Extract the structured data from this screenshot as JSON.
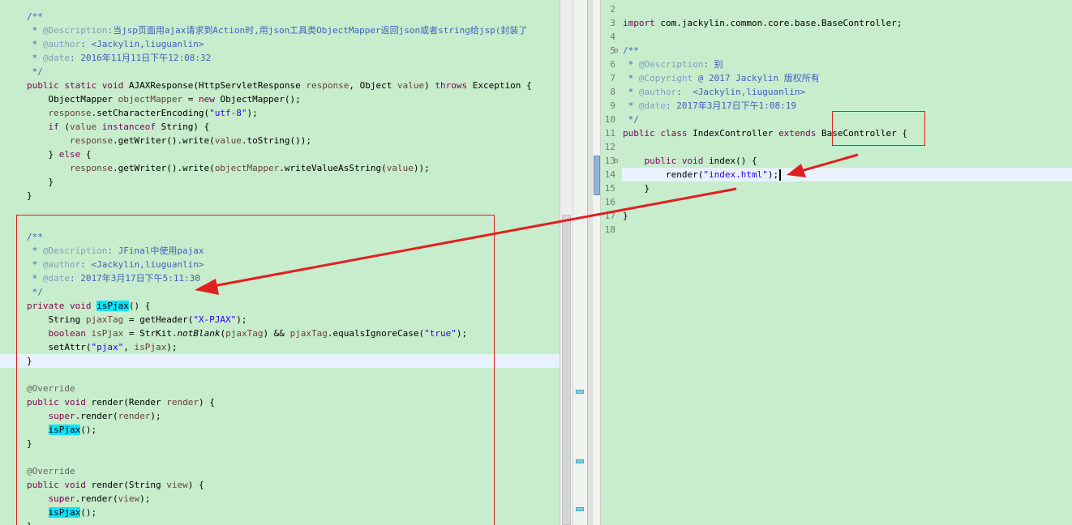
{
  "left_editor": {
    "lines": [
      [
        [
          "cm",
          "/**"
        ]
      ],
      [
        [
          "cm",
          " * "
        ],
        [
          "tag",
          "@Description"
        ],
        [
          "cm",
          ":当jsp页面用ajax请求到Action时,用json工具类ObjectMapper返回json或者string给jsp(封装了"
        ]
      ],
      [
        [
          "cm",
          " * "
        ],
        [
          "tag",
          "@author"
        ],
        [
          "cm",
          ": <Jackylin,liuguanlin>"
        ]
      ],
      [
        [
          "cm",
          " * "
        ],
        [
          "tag",
          "@date"
        ],
        [
          "cm",
          ": 2016年11月11日下午12:08:32"
        ]
      ],
      [
        [
          "cm",
          " */"
        ]
      ],
      [
        [
          "kw",
          "public static void "
        ],
        [
          "t",
          "AJAXResponse(HttpServletResponse "
        ],
        [
          "var",
          "response"
        ],
        [
          "t",
          ", Object "
        ],
        [
          "var",
          "value"
        ],
        [
          "t",
          ") "
        ],
        [
          "kw",
          "throws"
        ],
        [
          "t",
          " Exception {"
        ]
      ],
      [
        [
          "t",
          "    ObjectMapper "
        ],
        [
          "var",
          "objectMapper"
        ],
        [
          "t",
          " = "
        ],
        [
          "kw",
          "new"
        ],
        [
          "t",
          " ObjectMapper();"
        ]
      ],
      [
        [
          "t",
          "    "
        ],
        [
          "var",
          "response"
        ],
        [
          "t",
          ".setCharacterEncoding("
        ],
        [
          "str",
          "\"utf-8\""
        ],
        [
          "t",
          ");"
        ]
      ],
      [
        [
          "t",
          "    "
        ],
        [
          "kw",
          "if"
        ],
        [
          "t",
          " ("
        ],
        [
          "var",
          "value"
        ],
        [
          "t",
          " "
        ],
        [
          "kw",
          "instanceof"
        ],
        [
          "t",
          " String) {"
        ]
      ],
      [
        [
          "t",
          "        "
        ],
        [
          "var",
          "response"
        ],
        [
          "t",
          ".getWriter().write("
        ],
        [
          "var",
          "value"
        ],
        [
          "t",
          ".toString());"
        ]
      ],
      [
        [
          "t",
          "    } "
        ],
        [
          "kw",
          "else"
        ],
        [
          "t",
          " {"
        ]
      ],
      [
        [
          "t",
          "        "
        ],
        [
          "var",
          "response"
        ],
        [
          "t",
          ".getWriter().write("
        ],
        [
          "var",
          "objectMapper"
        ],
        [
          "t",
          ".writeValueAsString("
        ],
        [
          "var",
          "value"
        ],
        [
          "t",
          "));"
        ]
      ],
      [
        [
          "t",
          "    }"
        ]
      ],
      [
        [
          "t",
          "}"
        ]
      ],
      [],
      [],
      [
        [
          "cm",
          "/**"
        ]
      ],
      [
        [
          "cm",
          " * "
        ],
        [
          "tag",
          "@Description"
        ],
        [
          "cm",
          ": JFinal中使用pajax"
        ]
      ],
      [
        [
          "cm",
          " * "
        ],
        [
          "tag",
          "@author"
        ],
        [
          "cm",
          ": <Jackylin,liuguanlin>"
        ]
      ],
      [
        [
          "cm",
          " * "
        ],
        [
          "tag",
          "@date"
        ],
        [
          "cm",
          ": 2017年3月17日下午5:11:30"
        ]
      ],
      [
        [
          "cm",
          " */"
        ]
      ],
      [
        [
          "kw",
          "private void "
        ],
        [
          "hl",
          "isPjax"
        ],
        [
          "t",
          "() {"
        ]
      ],
      [
        [
          "t",
          "    String "
        ],
        [
          "var",
          "pjaxTag"
        ],
        [
          "t",
          " = getHeader("
        ],
        [
          "str",
          "\"X-PJAX\""
        ],
        [
          "t",
          ");"
        ]
      ],
      [
        [
          "t",
          "    "
        ],
        [
          "kw",
          "boolean"
        ],
        [
          "t",
          " "
        ],
        [
          "var",
          "isPjax"
        ],
        [
          "t",
          " = StrKit."
        ],
        [
          "ital",
          "notBlank"
        ],
        [
          "t",
          "("
        ],
        [
          "var",
          "pjaxTag"
        ],
        [
          "t",
          ") && "
        ],
        [
          "var",
          "pjaxTag"
        ],
        [
          "t",
          ".equalsIgnoreCase("
        ],
        [
          "str",
          "\"true\""
        ],
        [
          "t",
          ");"
        ]
      ],
      [
        [
          "t",
          "    setAttr("
        ],
        [
          "str",
          "\"pjax\""
        ],
        [
          "t",
          ", "
        ],
        [
          "var",
          "isPjax"
        ],
        [
          "t",
          ");"
        ]
      ],
      [
        [
          "t",
          "}"
        ]
      ],
      [],
      [
        [
          "ann",
          "@Override"
        ]
      ],
      [
        [
          "kw",
          "public void "
        ],
        [
          "t",
          "render(Render "
        ],
        [
          "var",
          "render"
        ],
        [
          "t",
          ") {"
        ]
      ],
      [
        [
          "t",
          "    "
        ],
        [
          "kw",
          "super"
        ],
        [
          "t",
          ".render("
        ],
        [
          "var",
          "render"
        ],
        [
          "t",
          ");"
        ]
      ],
      [
        [
          "t",
          "    "
        ],
        [
          "hl",
          "isPjax"
        ],
        [
          "t",
          "();"
        ]
      ],
      [
        [
          "t",
          "}"
        ]
      ],
      [],
      [
        [
          "ann",
          "@Override"
        ]
      ],
      [
        [
          "kw",
          "public void "
        ],
        [
          "t",
          "render(String "
        ],
        [
          "var",
          "view"
        ],
        [
          "t",
          ") {"
        ]
      ],
      [
        [
          "t",
          "    "
        ],
        [
          "kw",
          "super"
        ],
        [
          "t",
          ".render("
        ],
        [
          "var",
          "view"
        ],
        [
          "t",
          ");"
        ]
      ],
      [
        [
          "t",
          "    "
        ],
        [
          "hl",
          "isPjax"
        ],
        [
          "t",
          "();"
        ]
      ],
      [
        [
          "t",
          "}"
        ]
      ]
    ]
  },
  "right_editor": {
    "lines": [
      {
        "n": "2",
        "fold": false,
        "tokens": []
      },
      {
        "n": "3",
        "fold": false,
        "tokens": [
          [
            "kw",
            "import"
          ],
          [
            "t",
            " com.jackylin.common.core.base.BaseController;"
          ]
        ]
      },
      {
        "n": "4",
        "fold": false,
        "tokens": []
      },
      {
        "n": "5",
        "fold": true,
        "tokens": [
          [
            "cm",
            "/**"
          ]
        ]
      },
      {
        "n": "6",
        "fold": false,
        "tokens": [
          [
            "cm",
            " * "
          ],
          [
            "tag",
            "@Description"
          ],
          [
            "cm",
            ": 别"
          ]
        ]
      },
      {
        "n": "7",
        "fold": false,
        "tokens": [
          [
            "cm",
            " * "
          ],
          [
            "tag",
            "@Copyright"
          ],
          [
            "cm",
            " @ 2017 Jackylin 版权所有"
          ]
        ]
      },
      {
        "n": "8",
        "fold": false,
        "tokens": [
          [
            "cm",
            " * "
          ],
          [
            "tag",
            "@author"
          ],
          [
            "cm",
            ":  <Jackylin,liuguanlin>"
          ]
        ]
      },
      {
        "n": "9",
        "fold": false,
        "tokens": [
          [
            "cm",
            " * "
          ],
          [
            "tag",
            "@date"
          ],
          [
            "cm",
            ": 2017年3月17日下午1:08:19"
          ]
        ]
      },
      {
        "n": "10",
        "fold": false,
        "tokens": [
          [
            "cm",
            " */"
          ]
        ]
      },
      {
        "n": "11",
        "fold": false,
        "tokens": [
          [
            "kw",
            "public class "
          ],
          [
            "t",
            "IndexController "
          ],
          [
            "kw",
            "extends"
          ],
          [
            "t",
            " BaseController {"
          ]
        ]
      },
      {
        "n": "12",
        "fold": false,
        "tokens": []
      },
      {
        "n": "13",
        "fold": true,
        "tokens": [
          [
            "t",
            "    "
          ],
          [
            "kw",
            "public void "
          ],
          [
            "t",
            "index() {"
          ]
        ]
      },
      {
        "n": "14",
        "fold": false,
        "tokens": [
          [
            "t",
            "        render("
          ],
          [
            "str",
            "\"index.html\""
          ],
          [
            "t",
            ");"
          ],
          [
            "caret",
            ""
          ]
        ]
      },
      {
        "n": "15",
        "fold": false,
        "tokens": [
          [
            "t",
            "    }"
          ]
        ]
      },
      {
        "n": "16",
        "fold": false,
        "tokens": []
      },
      {
        "n": "17",
        "fold": false,
        "tokens": [
          [
            "t",
            "}"
          ]
        ]
      },
      {
        "n": "18",
        "fold": false,
        "tokens": []
      }
    ]
  },
  "colors": {
    "editor_bg": "#c7edcc",
    "keyword": "#7f0055",
    "comment": "#3f5fbf",
    "string": "#2a00ff",
    "highlight": "#00e5ff",
    "annotation_red": "#e02020"
  }
}
